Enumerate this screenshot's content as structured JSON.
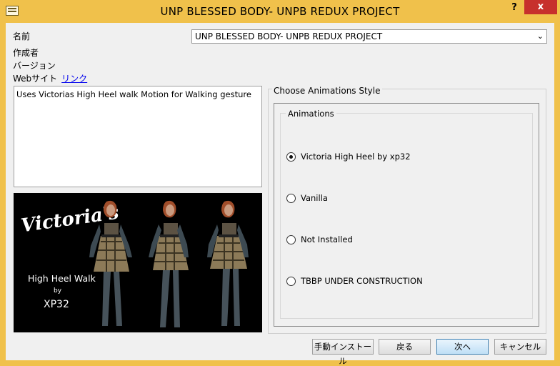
{
  "window": {
    "title": "UNP BLESSED BODY- UNPB REDUX PROJECT",
    "help_label": "?",
    "close_label": "x"
  },
  "info": {
    "name_label": "名前",
    "author_label": "作成者",
    "version_label": "バージョン",
    "website_label": "Webサイト",
    "website_link": "リンク",
    "selected_name": "UNP BLESSED BODY- UNPB REDUX PROJECT"
  },
  "description": "Uses Victorias High Heel walk Motion for Walking gesture",
  "preview": {
    "brand": "Victoria's",
    "line1": "High Heel Walk",
    "line2": "by",
    "line3": "XP32"
  },
  "group": {
    "outer_title": "Choose Animations Style",
    "inner_title": "Animations",
    "options": [
      {
        "label": "Victoria High Heel by xp32",
        "checked": true
      },
      {
        "label": "Vanilla",
        "checked": false
      },
      {
        "label": "Not Installed",
        "checked": false
      },
      {
        "label": "TBBP UNDER CONSTRUCTION",
        "checked": false
      }
    ]
  },
  "buttons": {
    "manual_install": "手動インストール",
    "back": "戻る",
    "next": "次へ",
    "cancel": "キャンセル"
  },
  "colors": {
    "titlebar": "#f0c14b",
    "close": "#c7302c",
    "link": "#0000ee",
    "dialog_bg": "#f0f0f0"
  }
}
